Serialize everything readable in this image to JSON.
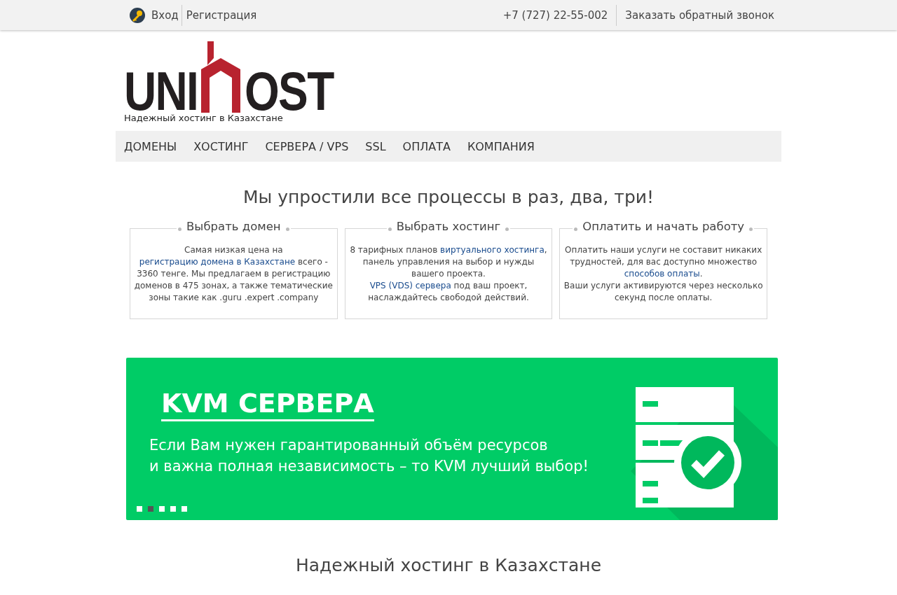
{
  "top_bar": {
    "login": "Вход",
    "register": "Регистрация",
    "phone": "+7 (727) 22-55-002",
    "callback": "Заказать обратный звонок"
  },
  "logo": {
    "left": "UNI",
    "right": "OST",
    "tagline": "Надежный хостинг в Казахстане"
  },
  "nav": {
    "items": [
      "ДОМЕНЫ",
      "ХОСТИНГ",
      "СЕРВЕРА / VPS",
      "SSL",
      "ОПЛАТА",
      "КОМПАНИЯ"
    ]
  },
  "intro": {
    "title": "Мы упростили все процессы в раз, два, три!"
  },
  "steps": [
    {
      "title": "Выбрать домен",
      "paragraphs": [
        [
          {
            "text": "Самая низкая цена на ",
            "link": false
          },
          {
            "text": "регистрацию домена в Казахстане",
            "link": true
          },
          {
            "text": " всего - 3360 тенге. Мы предлагаем в регистрацию доменов в 475 зонах, а также тематические зоны такие как .guru .expert .company",
            "link": false
          }
        ]
      ]
    },
    {
      "title": "Выбрать хостинг",
      "paragraphs": [
        [
          {
            "text": "8 тарифных планов ",
            "link": false
          },
          {
            "text": "виртуального хостинга",
            "link": true
          },
          {
            "text": ", панель управления на выбор и нужды вашего проекта.",
            "link": false
          }
        ],
        [
          {
            "text": "VPS (VDS) сервера",
            "link": true
          },
          {
            "text": " под ваш проект, наслаждайтесь свободой действий.",
            "link": false
          }
        ]
      ]
    },
    {
      "title": "Оплатить и начать работу",
      "paragraphs": [
        [
          {
            "text": "Оплатить наши услуги не составит никаких трудностей, для вас доступно множество ",
            "link": false
          },
          {
            "text": "способов оплаты",
            "link": true
          },
          {
            "text": ".",
            "link": false
          }
        ],
        [
          {
            "text": "Ваши услуги активируются через несколько секунд после оплаты.",
            "link": false
          }
        ]
      ]
    }
  ],
  "banner": {
    "title": "KVM СЕРВЕРА",
    "lines": [
      "Если Вам нужен гарантированный объём ресурсов",
      "и важна полная независимость – то KVM лучший выбор!"
    ],
    "dots": [
      {
        "selected": false
      },
      {
        "selected": true
      },
      {
        "selected": false
      },
      {
        "selected": false
      },
      {
        "selected": false
      }
    ]
  },
  "footer_heading": "Надежный хостинг в Казахстане"
}
